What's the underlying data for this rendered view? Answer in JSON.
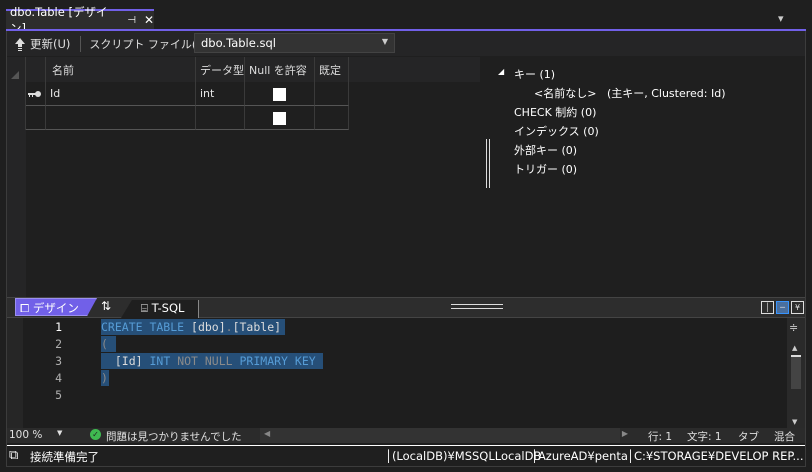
{
  "tab": {
    "title": "dbo.Table [デザイン]",
    "pin": "⊣",
    "close": "✕",
    "menu": "▾"
  },
  "toolbar": {
    "refresh_label": "更新(U)",
    "script_file_label": "スクリプト ファイル(I):",
    "script_file_value": "dbo.Table.sql"
  },
  "grid": {
    "headers": [
      "名前",
      "データ型",
      "Null を許容",
      "既定"
    ],
    "rows": [
      {
        "key": true,
        "name": "Id",
        "type": "int",
        "nullable": false
      },
      {
        "key": false,
        "name": "",
        "type": "",
        "nullable": false
      }
    ]
  },
  "tree": {
    "keys": "キー (1)",
    "key_item_name": "<名前なし>",
    "key_item_detail": "(主キー, Clustered: Id)",
    "check": "CHECK 制約 (0)",
    "indexes": "インデックス (0)",
    "foreign": "外部キー (0)",
    "triggers": "トリガー (0)"
  },
  "pane_tabs": {
    "design": "デザイン",
    "swap": "⇅",
    "tsql": "T-SQL"
  },
  "editor": {
    "line_numbers": [
      "1",
      "2",
      "3",
      "4",
      "5"
    ],
    "l1": [
      "CREATE TABLE ",
      "[dbo]",
      ".",
      "[Table]"
    ],
    "l2": "(",
    "l3": [
      "  ",
      "[Id]",
      " INT ",
      "NOT NULL",
      " PRIMARY KEY "
    ],
    "l4": ")"
  },
  "editor_status": {
    "zoom": "100 %",
    "issues": "問題は見つかりませんでした",
    "line": "行: 1",
    "char": "文字: 1",
    "tab": "タブ",
    "eol": "混合"
  },
  "status": {
    "ready": "接続準備完了",
    "server": "(LocalDB)¥MSSQLLocalDB",
    "user": "AzureAD¥penta",
    "path": "C:¥STORAGE¥DEVELOP REP..."
  },
  "colors": {
    "accent": "#7160e8",
    "selection": "#264f78",
    "keyword": "#569cd6"
  }
}
